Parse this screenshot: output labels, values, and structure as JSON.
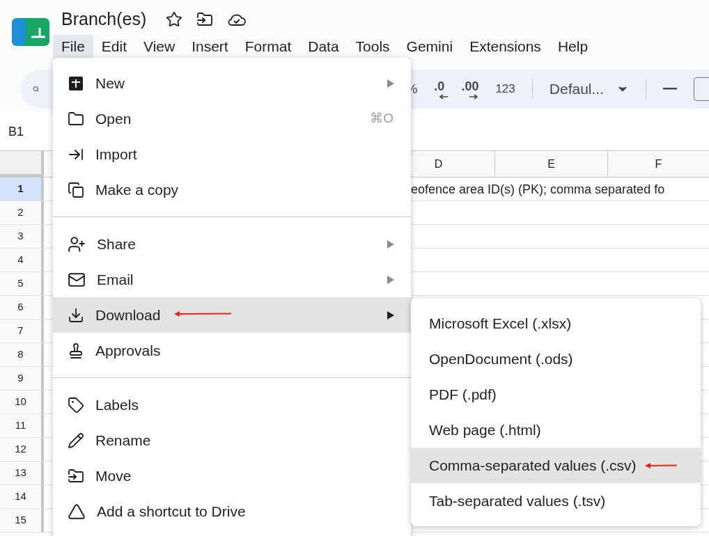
{
  "document": {
    "title": "Branch(es)"
  },
  "menubar": [
    {
      "label": "File",
      "selected": true
    },
    {
      "label": "Edit",
      "selected": false
    },
    {
      "label": "View",
      "selected": false
    },
    {
      "label": "Insert",
      "selected": false
    },
    {
      "label": "Format",
      "selected": false
    },
    {
      "label": "Data",
      "selected": false
    },
    {
      "label": "Tools",
      "selected": false
    },
    {
      "label": "Gemini",
      "selected": false
    },
    {
      "label": "Extensions",
      "selected": false
    },
    {
      "label": "Help",
      "selected": false
    }
  ],
  "toolbar": {
    "percent": "%",
    "decrease_decimals": ".0",
    "increase_decimals": ".00",
    "number_format": "123",
    "font": "Defaul..."
  },
  "name_box": "B1",
  "columns": [
    "D",
    "E",
    "F"
  ],
  "rows": [
    {
      "number": "1",
      "selected": true,
      "overflow": "eofence area ID(s) (PK); comma separated fo"
    },
    {
      "number": "2",
      "selected": false
    },
    {
      "number": "3",
      "selected": false
    },
    {
      "number": "4",
      "selected": false
    },
    {
      "number": "5",
      "selected": false
    },
    {
      "number": "6",
      "selected": false
    },
    {
      "number": "7",
      "selected": false
    },
    {
      "number": "8",
      "selected": false
    },
    {
      "number": "9",
      "selected": false
    },
    {
      "number": "10",
      "selected": false
    },
    {
      "number": "11",
      "selected": false
    },
    {
      "number": "12",
      "selected": false
    },
    {
      "number": "13",
      "selected": false
    },
    {
      "number": "14",
      "selected": false
    },
    {
      "number": "15",
      "selected": false
    }
  ],
  "file_menu": [
    {
      "kind": "item",
      "label": "New",
      "submenu": true,
      "selected": false
    },
    {
      "kind": "item",
      "label": "Open",
      "shortcut": "⌘O",
      "submenu": false,
      "selected": false
    },
    {
      "kind": "item",
      "label": "Import",
      "submenu": false,
      "selected": false
    },
    {
      "kind": "item",
      "label": "Make a copy",
      "submenu": false,
      "selected": false
    },
    {
      "kind": "divider"
    },
    {
      "kind": "item",
      "label": "Share",
      "submenu": true,
      "selected": false
    },
    {
      "kind": "item",
      "label": "Email",
      "submenu": true,
      "selected": false
    },
    {
      "kind": "item",
      "label": "Download",
      "submenu": true,
      "selected": true
    },
    {
      "kind": "item",
      "label": "Approvals",
      "submenu": false,
      "selected": false
    },
    {
      "kind": "divider"
    },
    {
      "kind": "item",
      "label": "Labels",
      "submenu": false,
      "selected": false
    },
    {
      "kind": "item",
      "label": "Rename",
      "submenu": false,
      "selected": false
    },
    {
      "kind": "item",
      "label": "Move",
      "submenu": false,
      "selected": false
    },
    {
      "kind": "item",
      "label": "Add a shortcut to Drive",
      "submenu": false,
      "selected": false
    }
  ],
  "download_menu": [
    {
      "label": "Microsoft Excel (.xlsx)",
      "selected": false
    },
    {
      "label": "OpenDocument (.ods)",
      "selected": false
    },
    {
      "label": "PDF (.pdf)",
      "selected": false
    },
    {
      "label": "Web page (.html)",
      "selected": false
    },
    {
      "label": "Comma-separated values (.csv)",
      "selected": true
    },
    {
      "label": "Tab-separated values (.tsv)",
      "selected": false
    }
  ]
}
